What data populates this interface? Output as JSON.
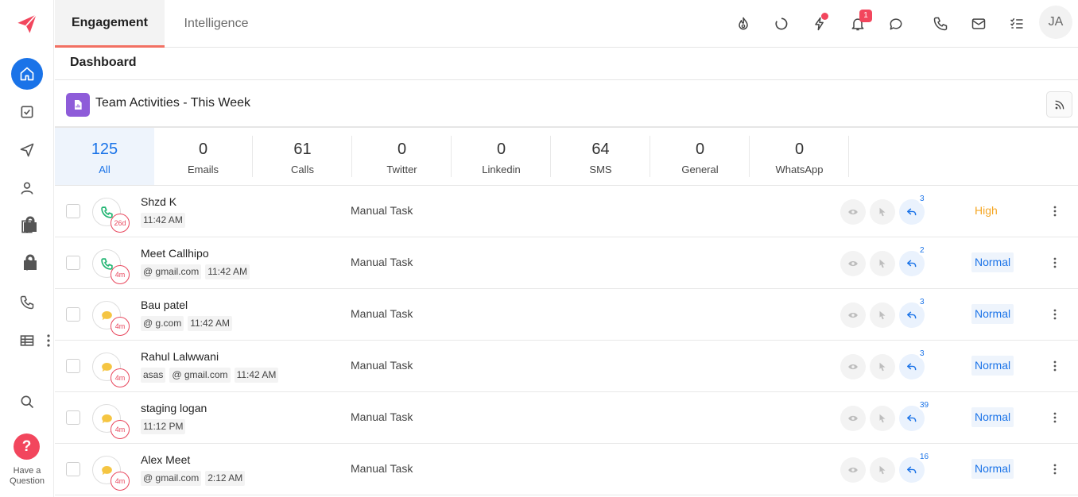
{
  "sidebar": {
    "items": [
      {
        "name": "home",
        "active": true
      },
      {
        "name": "tasks"
      },
      {
        "name": "sequences"
      },
      {
        "name": "contacts"
      },
      {
        "name": "accounts",
        "locked": true
      },
      {
        "name": "deals",
        "locked": true
      },
      {
        "name": "calls"
      },
      {
        "name": "reports"
      }
    ],
    "help": {
      "line1": "Have a",
      "line2": "Question",
      "icon_text": "?"
    }
  },
  "header": {
    "tabs": [
      {
        "label": "Engagement",
        "active": true
      },
      {
        "label": "Intelligence",
        "active": false
      }
    ],
    "icons": [
      "flame-icon",
      "loader-icon",
      "bolt-icon",
      "bell-icon",
      "chat-icon",
      "phone-icon",
      "mail-icon",
      "checklist-icon"
    ],
    "notification_count": "1",
    "avatar_initials": "JA"
  },
  "breadcrumb": {
    "title": "Dashboard"
  },
  "section": {
    "title": "Team Activities - This Week"
  },
  "stats": [
    {
      "value": "125",
      "label": "All",
      "active": true
    },
    {
      "value": "0",
      "label": "Emails"
    },
    {
      "value": "61",
      "label": "Calls"
    },
    {
      "value": "0",
      "label": "Twitter"
    },
    {
      "value": "0",
      "label": "Linkedin"
    },
    {
      "value": "64",
      "label": "SMS"
    },
    {
      "value": "0",
      "label": "General"
    },
    {
      "value": "0",
      "label": "WhatsApp"
    }
  ],
  "activities": [
    {
      "type": "call",
      "age": "26d",
      "name": "Shzd K",
      "meta": [
        "",
        "11:42 AM"
      ],
      "task": "Manual Task",
      "replies": "3",
      "priority": "High"
    },
    {
      "type": "call",
      "age": "4m",
      "name": "Meet Callhipo",
      "meta": [
        "@ gmail.com",
        "11:42 AM"
      ],
      "task": "Manual Task",
      "replies": "2",
      "priority": "Normal"
    },
    {
      "type": "sms",
      "age": "4m",
      "name": "Bau patel",
      "meta": [
        "@ g.com",
        "11:42 AM"
      ],
      "task": "Manual Task",
      "replies": "3",
      "priority": "Normal"
    },
    {
      "type": "sms",
      "age": "4m",
      "name": "Rahul Lalwwani",
      "meta": [
        "asas",
        "@ gmail.com",
        "11:42 AM"
      ],
      "task": "Manual Task",
      "replies": "3",
      "priority": "Normal"
    },
    {
      "type": "sms",
      "age": "4m",
      "name": "staging logan",
      "meta": [
        "",
        "11:12 PM"
      ],
      "task": "Manual Task",
      "replies": "39",
      "priority": "Normal"
    },
    {
      "type": "sms",
      "age": "4m",
      "name": "Alex Meet",
      "meta": [
        "@ gmail.com",
        "2:12 AM"
      ],
      "task": "Manual Task",
      "replies": "16",
      "priority": "Normal"
    }
  ],
  "colors": {
    "accent": "#1a73e8",
    "brand": "#f2465d",
    "call": "#22b573",
    "sms": "#f5c542",
    "high": "#f5a623"
  }
}
